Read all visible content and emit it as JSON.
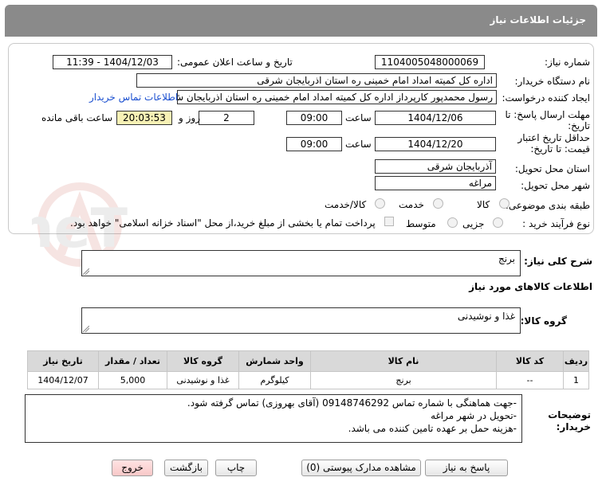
{
  "header": {
    "title": "جزئیات اطلاعات نیاز"
  },
  "fields": {
    "need_number_label": "شماره نیاز:",
    "need_number": "1104005048000069",
    "announce_label": "تاریخ و ساعت اعلان عمومی:",
    "announce_value": "1404/12/03 - 11:39",
    "buyer_org_label": "نام دستگاه خریدار:",
    "buyer_org": "اداره کل کمیته امداد امام خمینی  ره  استان اذربایجان شرقی",
    "creator_label": "ایجاد کننده درخواست:",
    "creator": "رسول محمدپور کارپرداز اداره کل کمیته امداد امام خمینی  ره  استان اذربایجان ش",
    "contact_link": "اطلاعات تماس خریدار",
    "deadline_label": "مهلت ارسال پاسخ: تا تاریخ:",
    "deadline_date": "1404/12/06",
    "time_label": "ساعت",
    "deadline_time": "09:00",
    "days_value": "2",
    "days_label": "روز و",
    "remaining_time": "20:03:53",
    "remaining_label": "ساعت باقی مانده",
    "validity_label": "حداقل تاریخ اعتبار قیمت: تا تاریخ:",
    "validity_date": "1404/12/20",
    "validity_time": "09:00",
    "province_label": "استان محل تحویل:",
    "province": "آذربایجان شرقی",
    "city_label": "شهر محل تحویل:",
    "city": "مراغه",
    "category_label": "طبقه بندی موضوعی:",
    "category_options": [
      "کالا",
      "خدمت",
      "کالا/خدمت"
    ],
    "process_label": "نوع فرآیند خرید :",
    "process_options": [
      "جزیی",
      "متوسط"
    ],
    "payment_note": "پرداخت تمام یا بخشی از مبلغ خرید،از محل \"اسناد خزانه اسلامی\" خواهد بود."
  },
  "summary": {
    "label": "شرح کلی نیاز:",
    "value": "برنج"
  },
  "goods_info_title": "اطلاعات کالاهای مورد نیاز",
  "goods_group": {
    "label": "گروه کالا:",
    "value": "غذا و نوشیدنی"
  },
  "table": {
    "headers": [
      "ردیف",
      "کد کالا",
      "نام کالا",
      "واحد شمارش",
      "گروه کالا",
      "تعداد / مقدار",
      "تاریخ نیاز"
    ],
    "rows": [
      [
        "1",
        "--",
        "برنج",
        "کیلوگرم",
        "غذا و نوشیدنی",
        "5,000",
        "1404/12/07"
      ]
    ]
  },
  "notes": {
    "label": "توضیحات خریدار:",
    "lines": [
      "-جهت هماهنگی با شماره تماس 09148746292 (آقای بهروزی) تماس گرفته شود.",
      "-تحویل در شهر مراغه",
      "-هزینه حمل بر عهده تامین کننده می باشد."
    ]
  },
  "buttons": {
    "reply": "پاسخ به نیاز",
    "docs": "مشاهده مدارک پیوستی (0)",
    "print": "چاپ",
    "back": "بازگشت",
    "exit": "خروج"
  },
  "watermark": {
    "text": "AriaTender.neT"
  },
  "colors": {
    "titlebar": "#8a8a8a",
    "highlight": "#f7f1b5",
    "link": "#1a4fd0",
    "exit_button": "#f8c8c8"
  }
}
